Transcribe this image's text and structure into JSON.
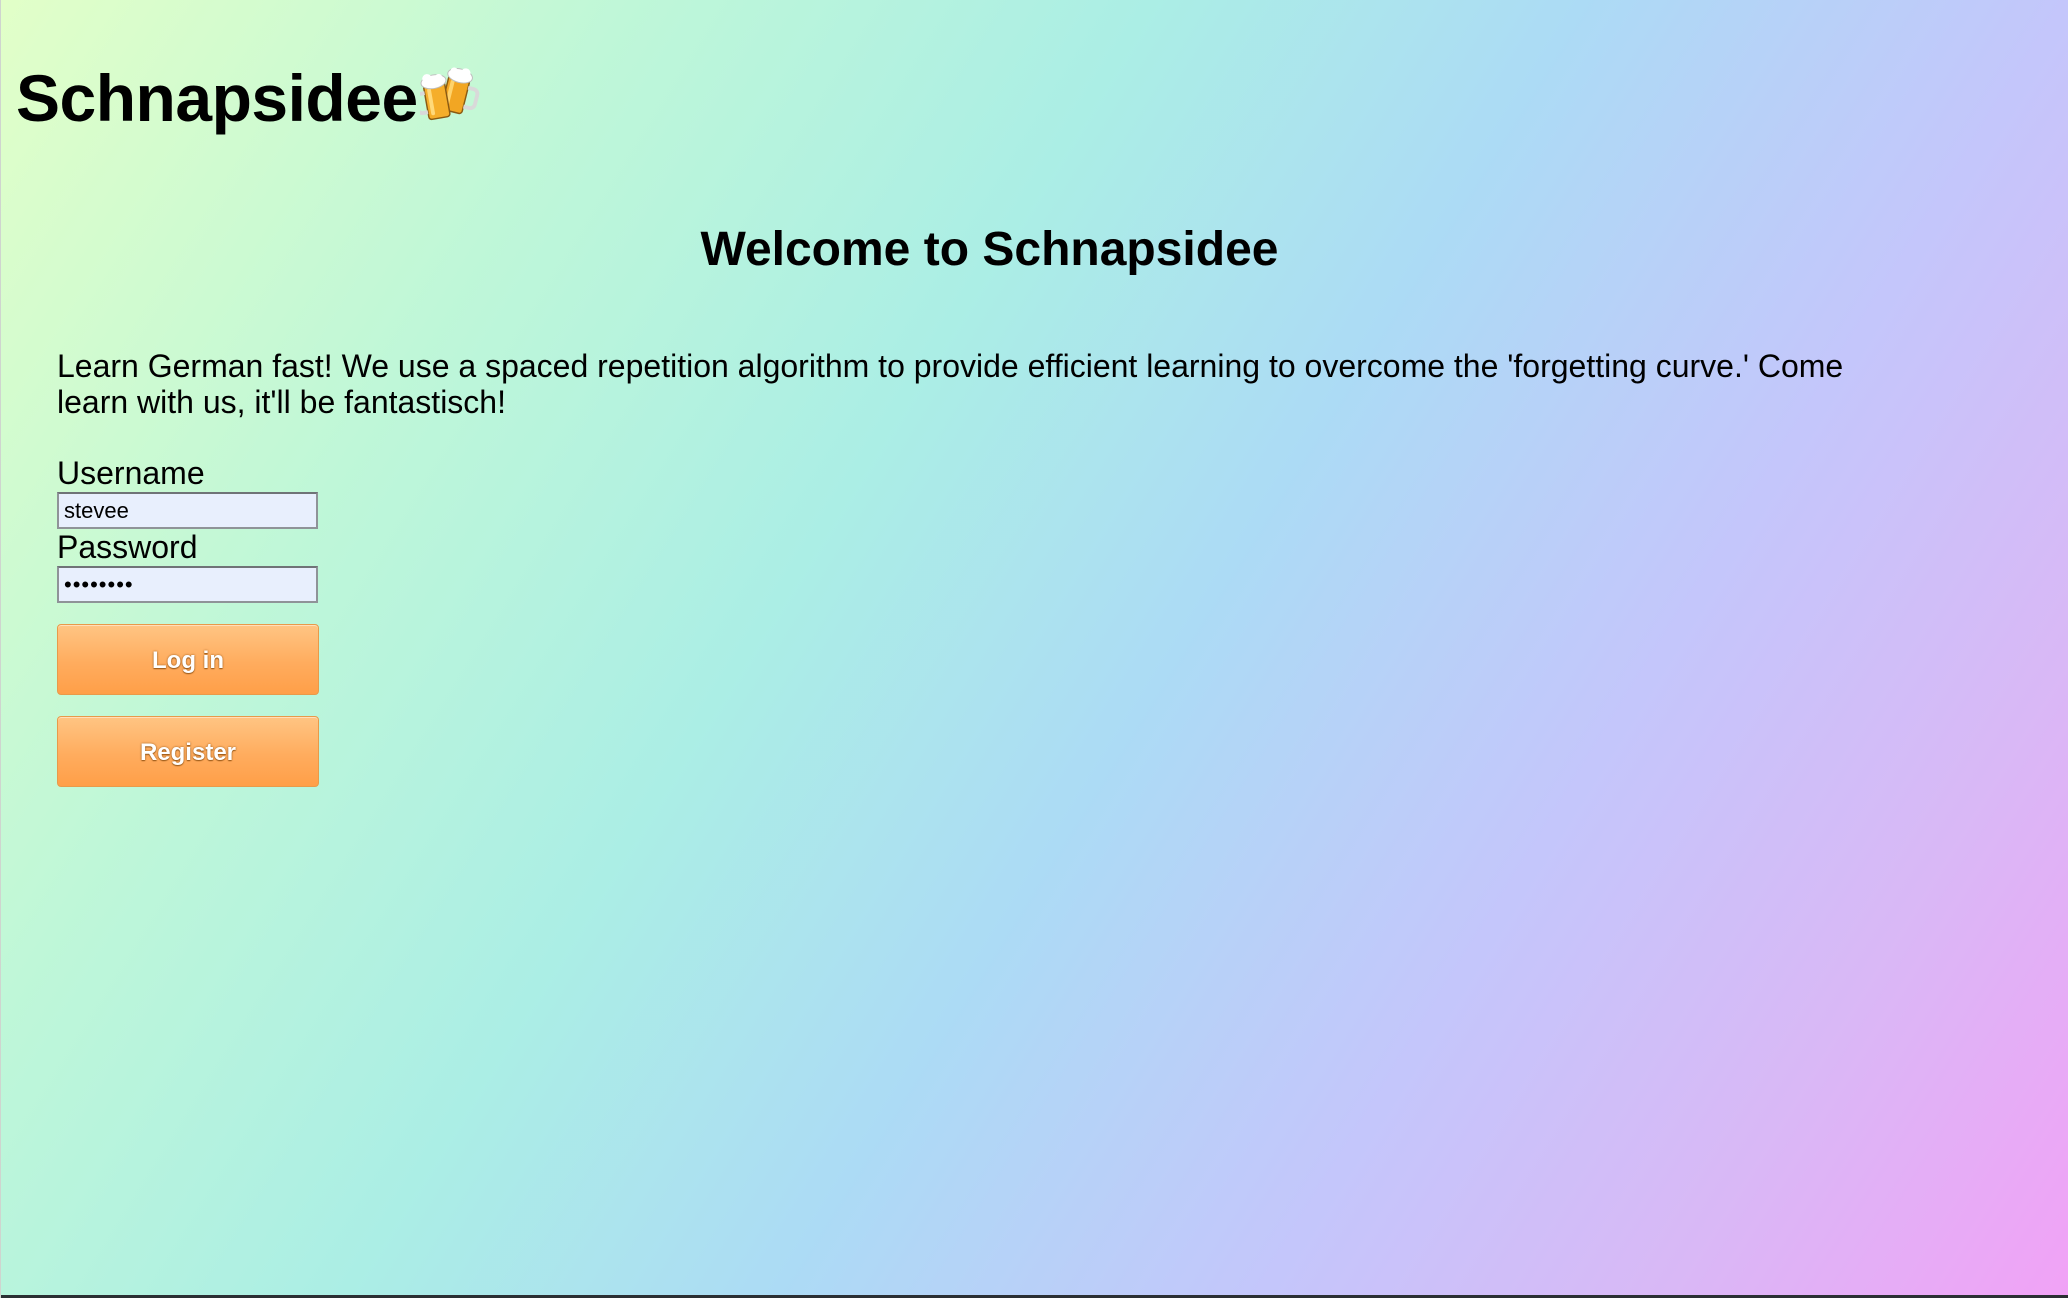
{
  "app": {
    "title": "Schnapsidee",
    "logo_icon": "clinking-beer-mugs-icon"
  },
  "main": {
    "heading": "Welcome to Schnapsidee",
    "intro": "Learn German fast! We use a spaced repetition algorithm to provide efficient learning to overcome the 'forgetting curve.' Come learn with us, it'll be fantastisch!"
  },
  "form": {
    "username_label": "Username",
    "username_value": "stevee",
    "password_label": "Password",
    "password_value": "••••••••",
    "login_label": "Log in",
    "register_label": "Register"
  },
  "colors": {
    "button_orange": "#ffac5e",
    "input_fill": "#e8effd"
  }
}
